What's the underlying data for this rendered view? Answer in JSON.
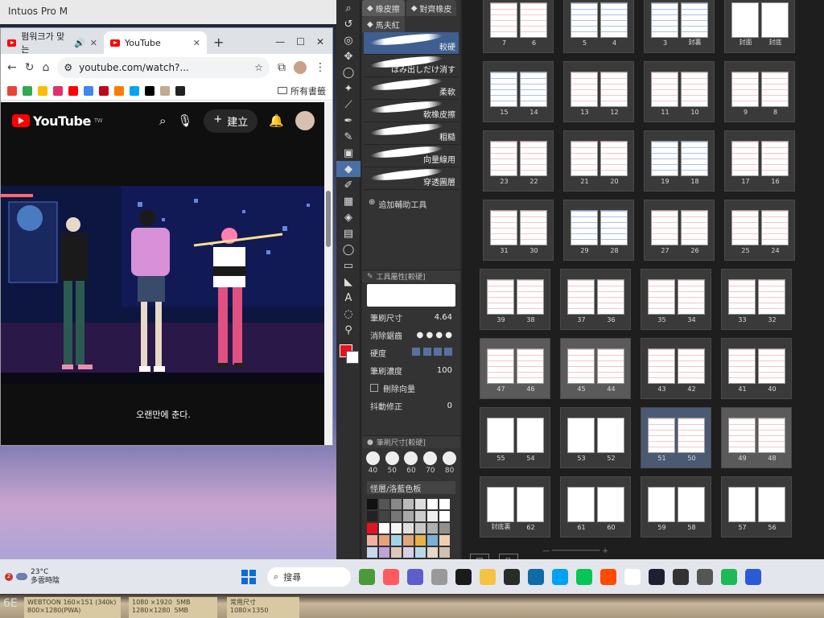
{
  "intuos": {
    "title": "Intuos Pro M"
  },
  "chrome": {
    "tabs": [
      {
        "label": "펌워크가 맞는",
        "active": false
      },
      {
        "label": "YouTube",
        "active": true
      }
    ],
    "new_tab": "+",
    "url": "youtube.com/watch?...",
    "bookmark_folder": "所有書籤",
    "bookmark_colors": [
      "#ea4335",
      "#34a853",
      "#fbbc05",
      "#e1306c",
      "#ff0000",
      "#4285f4",
      "#bd081c",
      "#ff7a00",
      "#00a4ef",
      "#000000",
      "#c1ab8d",
      "#222222"
    ]
  },
  "youtube": {
    "logo": "YouTube",
    "logo_sup": "TW",
    "create_label": "建立",
    "caption": "오랜만에 춘다."
  },
  "csp": {
    "tabs": [
      {
        "label": "橡皮擦",
        "active": true
      },
      {
        "label": "對齊橡皮",
        "active": false
      }
    ],
    "group_label": "馬夫紅",
    "brushes": [
      {
        "name": "較硬",
        "active": true
      },
      {
        "name": "はみ出しだけ消す",
        "active": false
      },
      {
        "name": "柔軟",
        "active": false
      },
      {
        "name": "軟橡皮擦",
        "active": false
      },
      {
        "name": "粗糙",
        "active": false
      },
      {
        "name": "向量線用",
        "active": false
      },
      {
        "name": "穿透圖層",
        "active": false
      }
    ],
    "add_tool": "追加輔助工具",
    "tool_prop_title": "工具屬性[較硬]",
    "props": {
      "brush_size_label": "筆刷尺寸",
      "brush_size_value": "4.64",
      "anti_alias_label": "消除鋸齒",
      "hardness_label": "硬度",
      "density_label": "筆刷濃度",
      "density_value": "100",
      "vector_erase_label": "刪除向量",
      "stabilization_label": "抖動修正",
      "stabilization_value": "0"
    },
    "brush_size_panel_title": "筆刷尺寸[較硬]",
    "size_presets": [
      "40",
      "50",
      "60",
      "70",
      "80"
    ],
    "palette_title": "怪層/洛藍色板",
    "palette": [
      "#111111",
      "#555555",
      "#888888",
      "#bbbbbb",
      "#dddddd",
      "#ffffff",
      "#ffffff",
      "#222222",
      "#444444",
      "#777777",
      "#aaaaaa",
      "#cccccc",
      "#eeeeee",
      "#ffffff",
      "#e8121e",
      "#ffffff",
      "#f5f5f5",
      "#e0e0e0",
      "#c8c8c8",
      "#b0b0b0",
      "#909090",
      "#f1b2a4",
      "#e7a07c",
      "#a1d3e6",
      "#dfa57c",
      "#e8b04a",
      "#7ab0d8",
      "#f0d0b0",
      "#c7d8ee",
      "#c2a0d8",
      "#e0c8b8",
      "#d8d0e8",
      "#b8d8e8",
      "#e8d8c8",
      "#d0c0b0",
      "#3a5fa8",
      "#5a7fc8",
      "#d8a0a0",
      "#2a3e88",
      "#c48f6a",
      "#f3c7ae",
      "#c08068",
      "#6a7fb8",
      "#8aa0d0",
      "#7a5a8a",
      "#5a4a7a",
      "#a07080",
      "#e0a890",
      "#b07060"
    ]
  },
  "pages": [
    [
      {
        "l": "7",
        "r": "6",
        "t": "sketch",
        "sel": false
      },
      {
        "l": "5",
        "r": "4",
        "t": "sketch-blue",
        "sel": false
      },
      {
        "l": "3",
        "r": "封裏",
        "t": "sketch-blue",
        "sel": false
      },
      {
        "l": "封面",
        "r": "封底",
        "t": "plain",
        "sel": false
      }
    ],
    [
      {
        "l": "15",
        "r": "14",
        "t": "sketch-blue",
        "sel": false
      },
      {
        "l": "13",
        "r": "12",
        "t": "sketch",
        "sel": false
      },
      {
        "l": "11",
        "r": "10",
        "t": "sketch",
        "sel": false
      },
      {
        "l": "9",
        "r": "8",
        "t": "sketch",
        "sel": false
      }
    ],
    [
      {
        "l": "23",
        "r": "22",
        "t": "sketch",
        "sel": false
      },
      {
        "l": "21",
        "r": "20",
        "t": "sketch",
        "sel": false
      },
      {
        "l": "19",
        "r": "18",
        "t": "sketch-blue",
        "sel": false
      },
      {
        "l": "17",
        "r": "16",
        "t": "sketch",
        "sel": false
      }
    ],
    [
      {
        "l": "31",
        "r": "30",
        "t": "sketch",
        "sel": false
      },
      {
        "l": "29",
        "r": "28",
        "t": "sketch-blue",
        "sel": false
      },
      {
        "l": "27",
        "r": "26",
        "t": "sketch",
        "sel": false
      },
      {
        "l": "25",
        "r": "24",
        "t": "sketch",
        "sel": false
      }
    ],
    [
      {
        "l": "39",
        "r": "38",
        "t": "sketch",
        "sel": false
      },
      {
        "l": "37",
        "r": "36",
        "t": "sketch",
        "sel": false
      },
      {
        "l": "35",
        "r": "34",
        "t": "sketch",
        "sel": false
      },
      {
        "l": "33",
        "r": "32",
        "t": "sketch",
        "sel": false
      }
    ],
    [
      {
        "l": "47",
        "r": "46",
        "t": "sketch",
        "sel": true
      },
      {
        "l": "45",
        "r": "44",
        "t": "sketch",
        "sel": true
      },
      {
        "l": "43",
        "r": "42",
        "t": "sketch",
        "sel": false
      },
      {
        "l": "41",
        "r": "40",
        "t": "sketch",
        "sel": false
      }
    ],
    [
      {
        "l": "55",
        "r": "54",
        "t": "plain",
        "sel": false
      },
      {
        "l": "53",
        "r": "52",
        "t": "plain",
        "sel": false
      },
      {
        "l": "51",
        "r": "50",
        "t": "sketch",
        "sel": "blue"
      },
      {
        "l": "49",
        "r": "48",
        "t": "sketch",
        "sel": true
      }
    ],
    [
      {
        "l": "封底裏",
        "r": "62",
        "t": "plain",
        "sel": false
      },
      {
        "l": "61",
        "r": "60",
        "t": "plain",
        "sel": false
      },
      {
        "l": "59",
        "r": "58",
        "t": "plain",
        "sel": false
      },
      {
        "l": "57",
        "r": "56",
        "t": "plain",
        "sel": false
      }
    ]
  ],
  "taskbar": {
    "weather_badge": "2",
    "temperature": "23°C",
    "weather_text": "多雲時陰",
    "search_label": "搜尋",
    "app_colors": [
      "#4a9a3a",
      "#ff5a5f",
      "#5b5fc7",
      "#999999",
      "#1b1b1b",
      "#f5c242",
      "#2b2b2b",
      "#0e6ba8",
      "#00a2ed",
      "#06c755",
      "#ff4a00",
      "#ffffff",
      "#1f1f2e",
      "#333333",
      "#555555",
      "#1db954",
      "#2a5bd7"
    ]
  },
  "bezel": {
    "left_text": "6E",
    "notes": [
      "WEBTOON 160×151 (340k)\n800×1280(PWA)",
      "1080 ×1920  5MB\n1280×1280  5MB",
      "常用尺寸\n1080×1350"
    ]
  }
}
